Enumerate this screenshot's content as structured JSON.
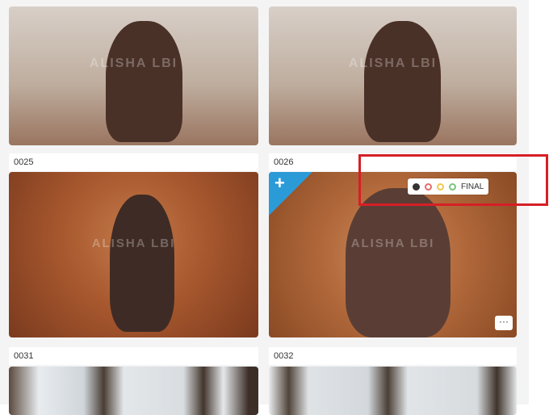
{
  "tiles": [
    {
      "number": "0025",
      "watermark": "ALISHA LBI"
    },
    {
      "number": "0026",
      "watermark": "ALISHA LBI"
    },
    {
      "number": "0031"
    },
    {
      "number": "0032"
    }
  ],
  "top_tiles": [
    {
      "watermark": "ALISHA LBI"
    },
    {
      "watermark": "ALISHA LBI"
    }
  ],
  "selection_toolbar": {
    "final_label": "FINAL",
    "colors": [
      "#333333",
      "#e86a6a",
      "#f2c94c",
      "#7bc47f"
    ]
  },
  "add_button": {
    "label": "+"
  },
  "more_button": {
    "label": "···"
  },
  "accent": "#2b9bd8",
  "highlight_color": "#d61f26"
}
